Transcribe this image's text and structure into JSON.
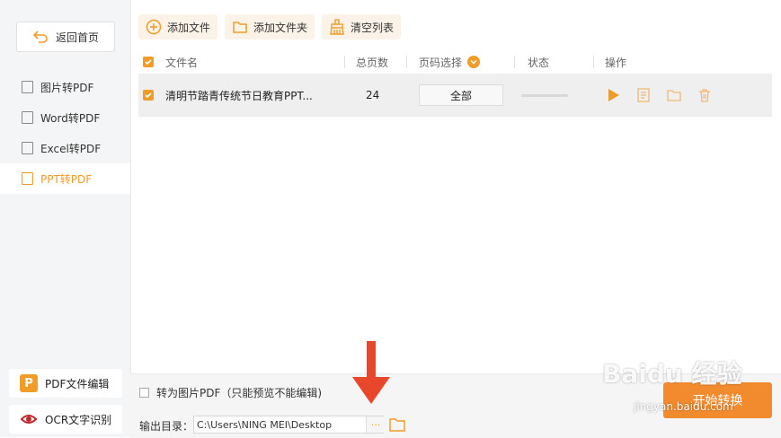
{
  "sidebar": {
    "back_label": "返回首页",
    "items": [
      {
        "label": "图片转PDF",
        "active": false
      },
      {
        "label": "Word转PDF",
        "active": false
      },
      {
        "label": "Excel转PDF",
        "active": false
      },
      {
        "label": "PPT转PDF",
        "active": true
      }
    ],
    "tools": [
      {
        "label": "PDF文件编辑",
        "icon": "P",
        "color": "#f09c28"
      },
      {
        "label": "OCR文字识别",
        "icon": "eye-icon",
        "color": "#c0292b"
      }
    ]
  },
  "toolbar": {
    "add_file": "添加文件",
    "add_folder": "添加文件夹",
    "clear_list": "清空列表"
  },
  "table": {
    "headers": [
      "文件名",
      "总页数",
      "页码选择",
      "状态",
      "操作"
    ],
    "rows": [
      {
        "name": "清明节踏青传统节日教育PPT...",
        "pages": "24",
        "page_select": "全部"
      }
    ]
  },
  "bottom": {
    "image_pdf_option": "转为图片PDF（只能预览不能编辑)",
    "output_label": "输出目录：",
    "output_path": "C:\\Users\\NING MEI\\Desktop",
    "browse": "···",
    "start_button": "开始转换"
  },
  "overlay": {
    "watermark": "Baidu 经验",
    "watermark_sub": "jingyan.baidu.com"
  },
  "colors": {
    "accent": "#f09c28",
    "start": "#f28a2e",
    "arrow": "#e8472b"
  }
}
